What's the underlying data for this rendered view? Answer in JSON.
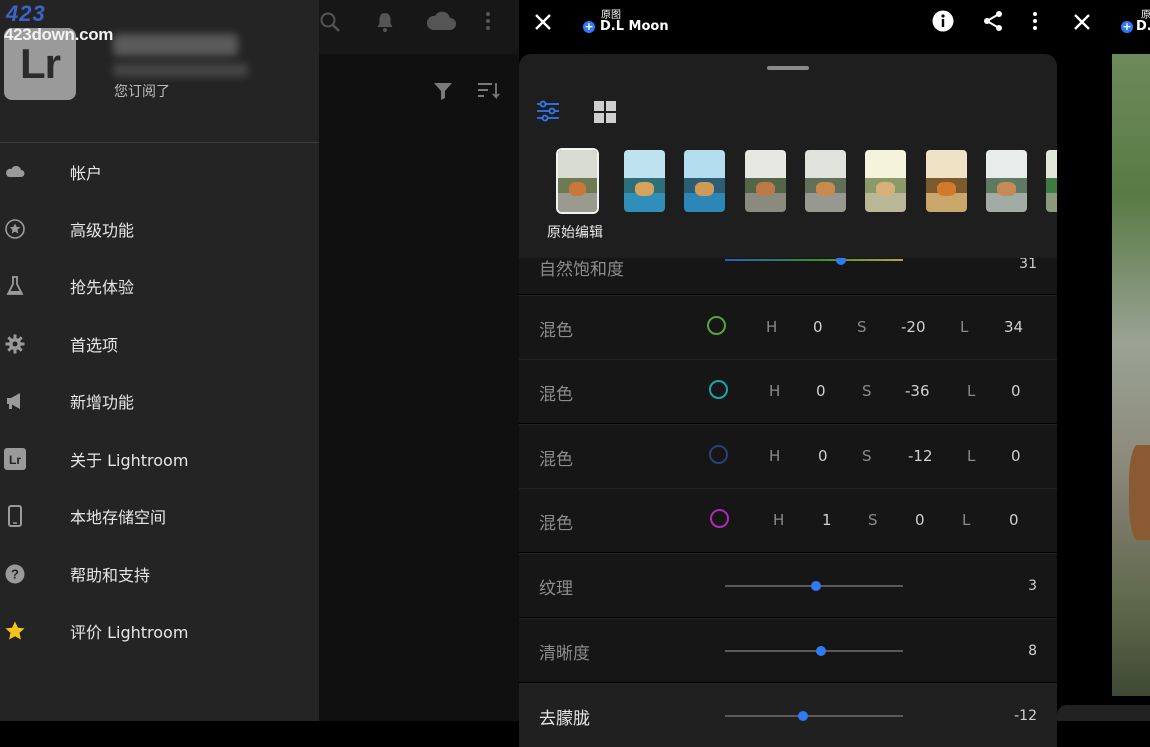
{
  "watermark": {
    "line1": "423",
    "line2": "423down.com"
  },
  "drawer": {
    "logo_text": "Lr",
    "subscription": "您订阅了",
    "items": [
      {
        "label": "帐户",
        "icon": "cloud-icon"
      },
      {
        "label": "高级功能",
        "icon": "star-circle-icon"
      },
      {
        "label": "抢先体验",
        "icon": "flask-icon"
      },
      {
        "label": "首选项",
        "icon": "gear-icon"
      },
      {
        "label": "新增功能",
        "icon": "megaphone-icon"
      },
      {
        "label": "关于 Lightroom",
        "icon": "lr-icon"
      },
      {
        "label": "本地存储空间",
        "icon": "phone-icon"
      },
      {
        "label": "帮助和支持",
        "icon": "help-icon"
      },
      {
        "label": "评价 Lightroom",
        "icon": "star-icon"
      }
    ]
  },
  "background_app": {
    "icons": [
      "search-icon",
      "bell-icon",
      "cloud-icon",
      "more-icon",
      "filter-icon",
      "sort-icon"
    ]
  },
  "editor": {
    "title_small": "原图",
    "title_main": "D.L Moon",
    "thumb_label": "原始编辑",
    "partial_row": {
      "label": "自然饱和度",
      "value": "31"
    },
    "mix_rows": [
      {
        "label": "混色",
        "color": "#5aa33b",
        "h": "0",
        "s": "-20",
        "l": "34",
        "h_label": "H",
        "s_label": "S",
        "l_label": "L"
      },
      {
        "label": "混色",
        "color": "#1aa6a6",
        "h": "0",
        "s": "-36",
        "l": "0",
        "h_label": "H",
        "s_label": "S",
        "l_label": "L"
      },
      {
        "label": "混色",
        "color": "#2e3f78",
        "h": "0",
        "s": "-12",
        "l": "0",
        "h_label": "H",
        "s_label": "S",
        "l_label": "L"
      },
      {
        "label": "混色",
        "color": "#b02ab5",
        "h": "1",
        "s": "0",
        "l": "0",
        "h_label": "H",
        "s_label": "S",
        "l_label": "L"
      }
    ],
    "slider_rows": [
      {
        "label": "纹理",
        "value": "3",
        "position": 0.51
      },
      {
        "label": "清晰度",
        "value": "8",
        "position": 0.54
      },
      {
        "label": "去朦胧",
        "value": "-12",
        "position": 0.44
      }
    ]
  },
  "right_preview": {
    "title_small": "原",
    "title_main": "D."
  },
  "colors": {
    "accent": "#2f7bf5",
    "drawer_bg": "#242424",
    "panel_bg": "#1e1e1e"
  }
}
